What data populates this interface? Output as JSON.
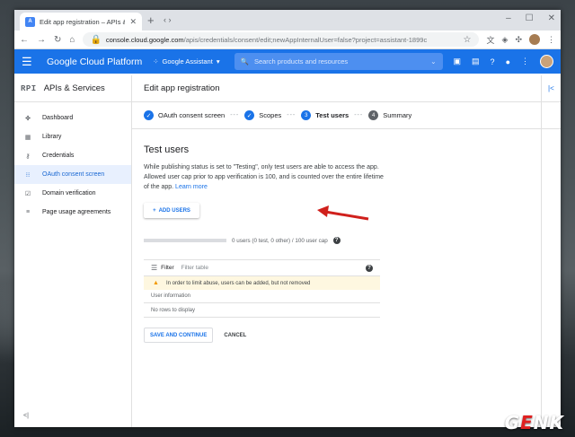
{
  "browser": {
    "tab_title": "Edit app registration – APIs & Se...",
    "url_host": "console.cloud.google.com",
    "url_path": "/apis/credentials/consent/edit;newAppInternalUser=false?project=assistant-1899c"
  },
  "header": {
    "brand": "Google Cloud Platform",
    "project": "Google Assistant",
    "search_placeholder": "Search products and resources"
  },
  "sidebar": {
    "logo": "RPI",
    "title": "APIs & Services",
    "items": [
      {
        "label": "Dashboard",
        "icon": "dashboard-icon"
      },
      {
        "label": "Library",
        "icon": "library-icon"
      },
      {
        "label": "Credentials",
        "icon": "key-icon"
      },
      {
        "label": "OAuth consent screen",
        "icon": "consent-icon",
        "active": true
      },
      {
        "label": "Domain verification",
        "icon": "domain-icon"
      },
      {
        "label": "Page usage agreements",
        "icon": "agreements-icon"
      }
    ],
    "collapse": "<|"
  },
  "main": {
    "title": "Edit app registration",
    "steps": [
      {
        "label": "OAuth consent screen",
        "state": "done"
      },
      {
        "label": "Scopes",
        "state": "done"
      },
      {
        "num": "3",
        "label": "Test users",
        "state": "current"
      },
      {
        "num": "4",
        "label": "Summary",
        "state": "pending"
      }
    ],
    "section_title": "Test users",
    "description": "While publishing status is set to \"Testing\", only test users are able to access the app. Allowed user cap prior to app verification is 100, and is counted over the entire lifetime of the app.",
    "learn_more": "Learn more",
    "add_users_label": "ADD USERS",
    "quota_text": "0 users (0 test, 0 other) / 100 user cap",
    "filter_label": "Filter",
    "filter_placeholder": "Filter table",
    "warning": "In order to limit abuse, users can be added, but not removed",
    "column_header": "User information",
    "empty_text": "No rows to display",
    "save_label": "SAVE AND CONTINUE",
    "cancel_label": "CANCEL"
  },
  "watermark": {
    "prefix": "G",
    "accent": "E",
    "suffix": "NK"
  },
  "colors": {
    "accent": "#1a73e8",
    "header": "#1a73e8",
    "warning_bg": "#fef7e0",
    "arrow": "#d0201c"
  }
}
